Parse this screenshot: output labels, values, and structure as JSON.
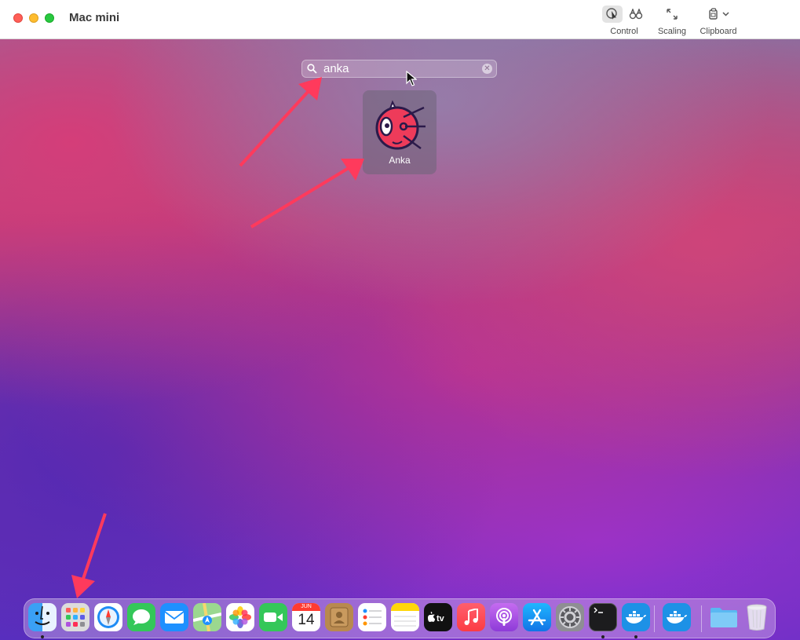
{
  "window": {
    "title": "Mac mini"
  },
  "toolbar": {
    "control_label": "Control",
    "scaling_label": "Scaling",
    "clipboard_label": "Clipboard"
  },
  "launchpad": {
    "search": {
      "value": "anka",
      "icon": "search-icon"
    },
    "results": [
      {
        "label": "Anka"
      }
    ]
  },
  "calendar_icon": {
    "month": "JUN",
    "day": "14"
  },
  "dock": {
    "items": [
      "finder",
      "launchpad",
      "safari",
      "messages",
      "mail",
      "maps",
      "photos",
      "facetime",
      "calendar",
      "contacts",
      "reminders",
      "notes",
      "apple-tv",
      "music",
      "podcasts",
      "app-store",
      "system-preferences",
      "terminal",
      "docker",
      "docker",
      "folder",
      "trash"
    ]
  },
  "colors": {
    "annotation_arrow": "#ff3a5c",
    "accent": "#0a84ff"
  }
}
